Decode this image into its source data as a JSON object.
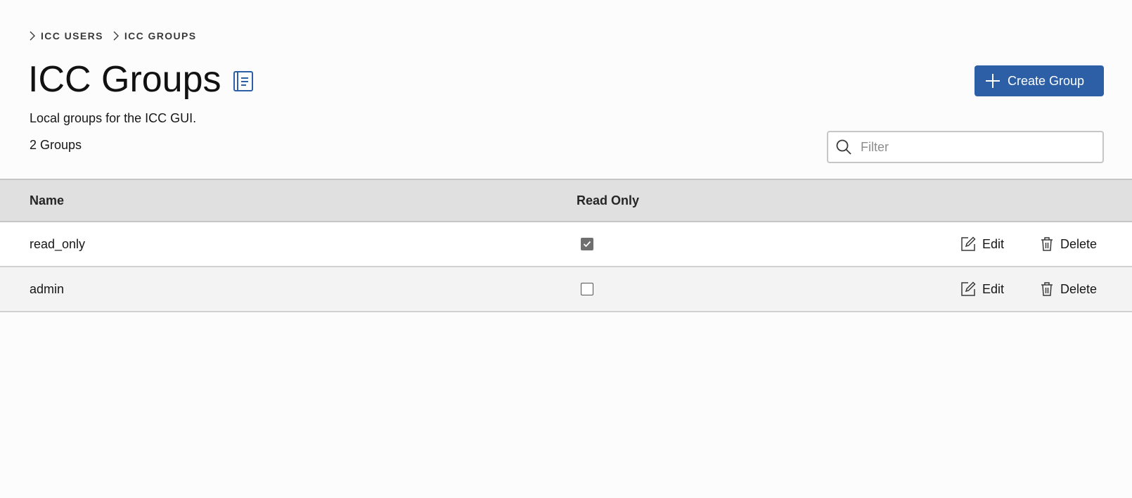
{
  "breadcrumb": [
    {
      "label": "ICC USERS"
    },
    {
      "label": "ICC GROUPS"
    }
  ],
  "header": {
    "title": "ICC Groups",
    "docs_icon": "book-icon",
    "create_button": {
      "label": "Create Group",
      "icon": "plus-icon"
    }
  },
  "description": "Local groups for the ICC GUI.",
  "count_label": "2 Groups",
  "filter": {
    "placeholder": "Filter",
    "value": "",
    "icon": "search-icon"
  },
  "table": {
    "columns": [
      "Name",
      "Read Only"
    ],
    "rows": [
      {
        "name": "read_only",
        "read_only": true,
        "edit_label": "Edit",
        "delete_label": "Delete"
      },
      {
        "name": "admin",
        "read_only": false,
        "edit_label": "Edit",
        "delete_label": "Delete"
      }
    ]
  },
  "colors": {
    "accent": "#2d5fa6",
    "header_bg": "#e0e0e0",
    "page_bg": "#fcfcfc",
    "row_alt_bg": "#f3f3f3"
  }
}
